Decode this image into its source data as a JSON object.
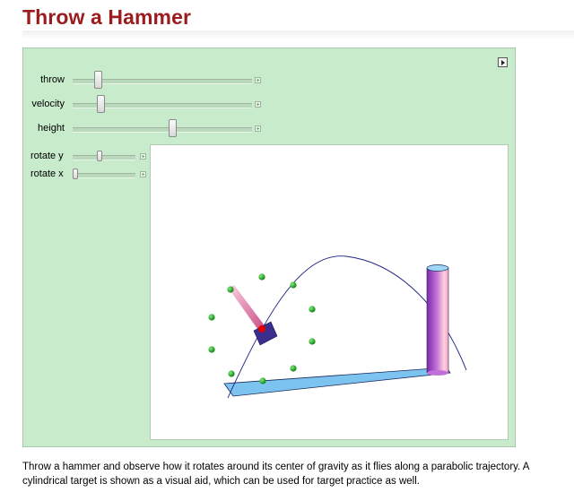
{
  "page": {
    "title": "Throw a Hammer",
    "description": "Throw a hammer and observe how it rotates around its center of gravity as it flies along a parabolic trajectory. A cylindrical target is shown as a visual aid, which can be used for target practice as well."
  },
  "controls": {
    "throw_label": "throw",
    "velocity_label": "velocity",
    "height_label": "height",
    "rotate_y_label": "rotate y",
    "rotate_x_label": "rotate x",
    "throw_value": 0.13,
    "velocity_value": 0.16,
    "height_value": 0.55,
    "rotate_y_value": 0.36,
    "rotate_x_value": 0.0
  },
  "scene": {
    "colors": {
      "trajectory": "#1a237e",
      "ground": "#7cc3f0",
      "target_light": "#ffc8d8",
      "target_dark": "#8a30b8",
      "hammer_handle": "#e0709c",
      "hammer_head": "#3a2f8f",
      "gravity_center": "#e00000",
      "marker": "#18b418"
    },
    "icons": [
      "play-icon",
      "plus-icon"
    ]
  }
}
